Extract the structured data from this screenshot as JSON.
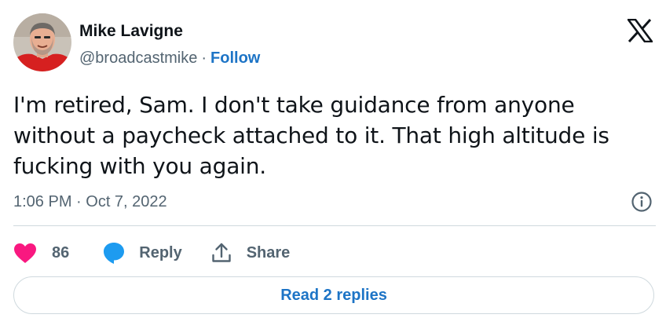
{
  "author": {
    "name": "Mike Lavigne",
    "handle": "@broadcastmike",
    "separator": "·",
    "follow_label": "Follow"
  },
  "tweet": {
    "text": "I'm retired, Sam. I don't take guidance from anyone\nwithout a paycheck attached to it. That high altitude is\nfucking with you again.",
    "timestamp": "1:06 PM · Oct 7, 2022"
  },
  "actions": {
    "like_count": "86",
    "reply_label": "Reply",
    "share_label": "Share"
  },
  "read_replies_label": "Read 2 replies",
  "icons": {
    "brand": "x-logo-icon",
    "info": "info-icon",
    "like": "heart-icon",
    "reply": "speech-bubble-icon",
    "share": "share-upload-icon"
  },
  "colors": {
    "text_primary": "#0f1419",
    "text_secondary": "#536471",
    "link_blue": "#1d74c6",
    "heart_pink": "#f91880",
    "reply_blue": "#1d9bf0",
    "divider": "#cfd9de"
  }
}
